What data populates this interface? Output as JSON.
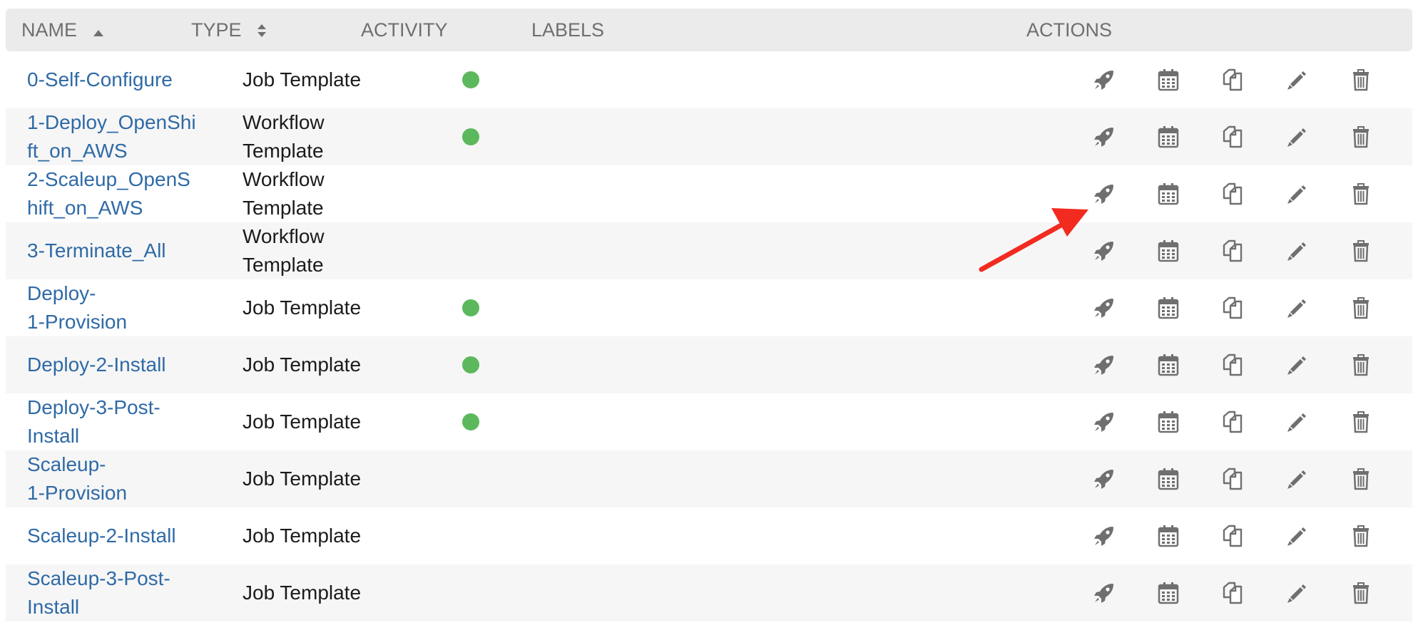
{
  "header": {
    "name": "NAME",
    "type": "TYPE",
    "activity": "ACTIVITY",
    "labels": "LABELS",
    "actions": "ACTIONS"
  },
  "rows": [
    {
      "name": [
        "0-Self-Configure"
      ],
      "type": [
        "Job Template"
      ],
      "activity": true
    },
    {
      "name": [
        "1-Deploy_OpenShi",
        "ft_on_AWS"
      ],
      "type": [
        "Workflow",
        "Template"
      ],
      "activity": true
    },
    {
      "name": [
        "2-Scaleup_OpenS",
        "hift_on_AWS"
      ],
      "type": [
        "Workflow",
        "Template"
      ],
      "activity": false
    },
    {
      "name": [
        "3-Terminate_All"
      ],
      "type": [
        "Workflow",
        "Template"
      ],
      "activity": false
    },
    {
      "name": [
        "Deploy-",
        "1-Provision"
      ],
      "type": [
        "Job Template"
      ],
      "activity": true
    },
    {
      "name": [
        "Deploy-2-Install"
      ],
      "type": [
        "Job Template"
      ],
      "activity": true
    },
    {
      "name": [
        "Deploy-3-Post-",
        "Install"
      ],
      "type": [
        "Job Template"
      ],
      "activity": true
    },
    {
      "name": [
        "Scaleup-",
        "1-Provision"
      ],
      "type": [
        "Job Template"
      ],
      "activity": false
    },
    {
      "name": [
        "Scaleup-2-Install"
      ],
      "type": [
        "Job Template"
      ],
      "activity": false
    },
    {
      "name": [
        "Scaleup-3-Post-",
        "Install"
      ],
      "type": [
        "Job Template"
      ],
      "activity": false
    }
  ],
  "action_icons": [
    "rocket-icon",
    "calendar-icon",
    "copy-icon",
    "pencil-icon",
    "trash-icon"
  ],
  "colors": {
    "link": "#2f6aa6",
    "activity_success": "#5cb85c",
    "header_bg": "#ebebeb",
    "icon": "#6f6f6f",
    "annotation_arrow": "#f22b20"
  }
}
